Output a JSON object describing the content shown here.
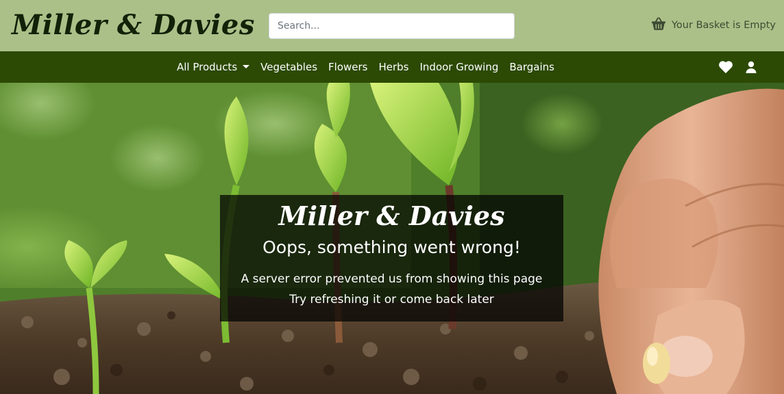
{
  "header": {
    "brand": "Miller & Davies",
    "search_placeholder": "Search...",
    "basket_label": "Your Basket is Empty",
    "basket_icon": "basket-icon"
  },
  "nav": {
    "items": [
      {
        "label": "All Products",
        "dropdown": true
      },
      {
        "label": "Vegetables"
      },
      {
        "label": "Flowers"
      },
      {
        "label": "Herbs"
      },
      {
        "label": "Indoor Growing"
      },
      {
        "label": "Bargains"
      }
    ],
    "icons": [
      "heart-icon",
      "user-icon"
    ]
  },
  "error": {
    "brand": "Miller & Davies",
    "title": "Oops, something went wrong!",
    "line1": "A server error prevented us from showing this page",
    "line2": "Try refreshing it or come back later"
  },
  "colors": {
    "header_bg": "#abc088",
    "nav_bg": "#2c4a03",
    "brand_text": "#112208",
    "overlay": "rgba(0,0,0,0.72)"
  }
}
